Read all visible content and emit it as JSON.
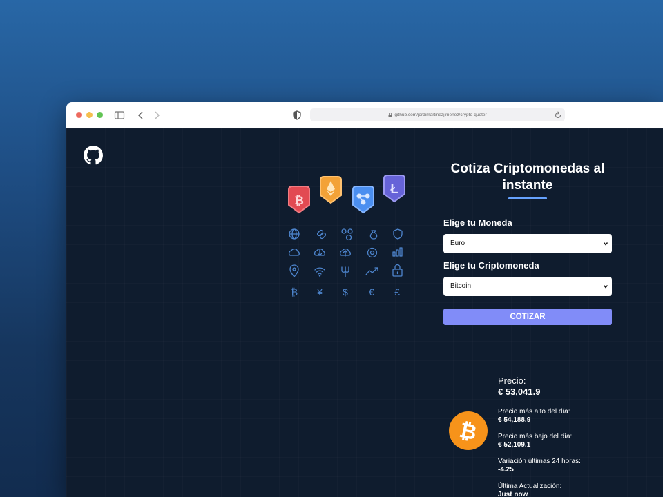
{
  "browser": {
    "url": "github.com/jordimartinezjimenez/crypto-quoter"
  },
  "icons": {
    "github": "github-icon",
    "badges": [
      "bitcoin-badge-icon",
      "ethereum-badge-icon",
      "ripple-badge-icon",
      "litecoin-badge-icon"
    ],
    "grid": [
      "globe",
      "link",
      "molecule",
      "money-bag",
      "shield",
      "cloud",
      "cloud-download",
      "cloud-upload",
      "gear",
      "bar-chart",
      "location-pin",
      "wifi",
      "fork",
      "trend-up",
      "lock",
      "bitcoin",
      "yen",
      "dollar",
      "euro",
      "pound"
    ]
  },
  "form": {
    "title": "Cotiza Criptomonedas al instante",
    "currency_label": "Elige tu Moneda",
    "currency_value": "Euro",
    "crypto_label": "Elige tu Criptomoneda",
    "crypto_value": "Bitcoin",
    "submit_label": "COTIZAR"
  },
  "result": {
    "price_label": "Precio:",
    "price_value": "€ 53,041.9",
    "high_label": "Precio más alto del día:",
    "high_value": "€ 54,188.9",
    "low_label": "Precio más bajo del día:",
    "low_value": "€ 52,109.1",
    "change_label": "Variación últimas 24 horas:",
    "change_value": "-4.25",
    "updated_label": "Última Actualización:",
    "updated_value": "Just now"
  },
  "colors": {
    "page_bg": "#0f1c2e",
    "accent": "#66a2fe",
    "button": "#818cf8",
    "bitcoin": "#f7931a"
  }
}
